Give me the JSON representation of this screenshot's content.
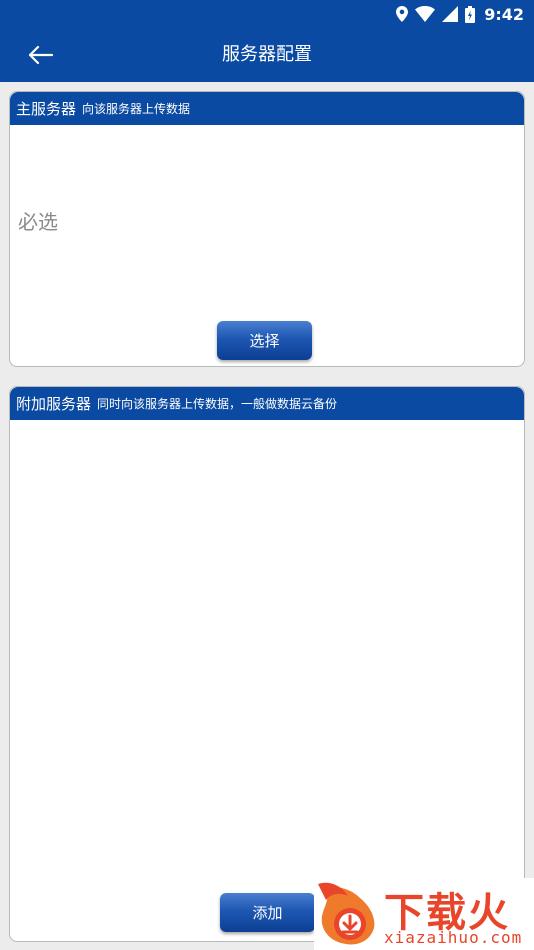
{
  "status_bar": {
    "time": "9:42",
    "icons": [
      "location-icon",
      "wifi-icon",
      "signal-icon",
      "battery-icon"
    ]
  },
  "app_bar": {
    "back_icon": "arrow-left-icon",
    "title": "服务器配置"
  },
  "primary_server": {
    "title": "主服务器",
    "subtitle": "向该服务器上传数据",
    "placeholder": "必选",
    "button_label": "选择"
  },
  "additional_server": {
    "title": "附加服务器",
    "subtitle": "同时向该服务器上传数据，一般做数据云备份",
    "button_label": "添加"
  },
  "watermark": {
    "name": "下载火",
    "url": "xiazaihuo.com"
  },
  "colors": {
    "primary": "#0b4aa2",
    "background": "#ececec",
    "placeholder_text": "#8a8a8a",
    "watermark": "#e8452a"
  }
}
